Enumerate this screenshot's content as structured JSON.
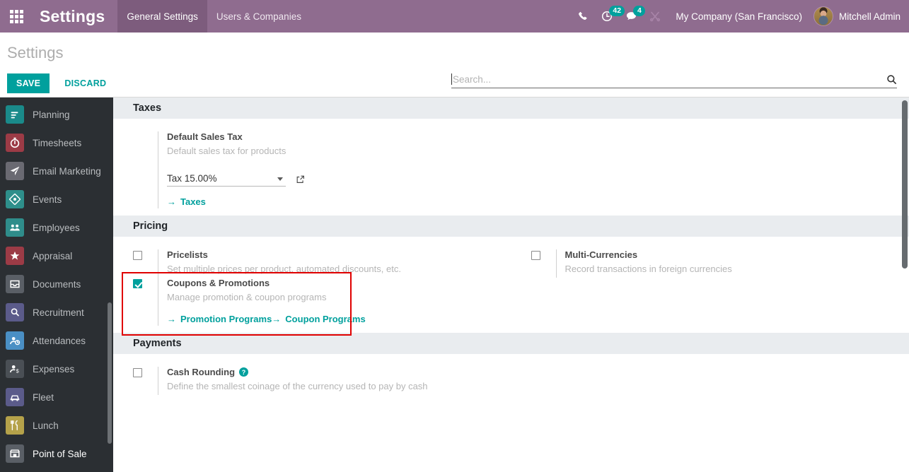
{
  "navbar": {
    "apps_icon": "grid-apps-icon",
    "brand": "Settings",
    "menus": [
      {
        "label": "General Settings",
        "active": true
      },
      {
        "label": "Users & Companies",
        "active": false
      }
    ],
    "icons": [
      {
        "name": "phone-icon",
        "badge": null
      },
      {
        "name": "activity-clock-icon",
        "badge": "42"
      },
      {
        "name": "messages-chat-icon",
        "badge": "4"
      },
      {
        "name": "tools-wrench-icon",
        "badge": null
      }
    ],
    "company": "My Company (San Francisco)",
    "user": "Mitchell Admin",
    "accent_badge_color": "#00A09D",
    "bar_color": "#8f6c8f"
  },
  "control_panel": {
    "title": "Settings",
    "save_label": "SAVE",
    "discard_label": "DISCARD",
    "save_color": "#00A09D"
  },
  "search": {
    "placeholder": "Search...",
    "value": "",
    "icon": "search-icon"
  },
  "sidebar": {
    "items": [
      {
        "label": "Planning",
        "icon_color": "#1a8a8a",
        "glyph": "planning",
        "hover": false
      },
      {
        "label": "Timesheets",
        "icon_color": "#9c3b46",
        "glyph": "timer",
        "hover": false
      },
      {
        "label": "Email Marketing",
        "icon_color": "#6a6a72",
        "glyph": "paperplane",
        "hover": false
      },
      {
        "label": "Events",
        "icon_color": "#2e8f8b",
        "glyph": "ticket",
        "hover": false
      },
      {
        "label": "Employees",
        "icon_color": "#2f8d8b",
        "glyph": "people",
        "hover": false
      },
      {
        "label": "Appraisal",
        "icon_color": "#9c3b46",
        "glyph": "star",
        "hover": false
      },
      {
        "label": "Documents",
        "icon_color": "#5a5f66",
        "glyph": "inbox",
        "hover": false
      },
      {
        "label": "Recruitment",
        "icon_color": "#5b5b8a",
        "glyph": "magnifier",
        "hover": false
      },
      {
        "label": "Attendances",
        "icon_color": "#4a8fc4",
        "glyph": "personclock",
        "hover": false
      },
      {
        "label": "Expenses",
        "icon_color": "#4a4f55",
        "glyph": "persondollar",
        "hover": false
      },
      {
        "label": "Fleet",
        "icon_color": "#5b5b8a",
        "glyph": "car",
        "hover": false
      },
      {
        "label": "Lunch",
        "icon_color": "#b5a24a",
        "glyph": "cutlery",
        "hover": false
      },
      {
        "label": "Point of Sale",
        "icon_color": "#5a5f66",
        "glyph": "shop",
        "hover": true
      }
    ]
  },
  "settings": {
    "sections": [
      {
        "title": "Taxes",
        "blocks": [
          {
            "kind": "select",
            "title": "Default Sales Tax",
            "desc": "Default sales tax for products",
            "select_value": "Tax 15.00%",
            "select_options": [
              "Tax 15.00%"
            ],
            "external_link_icon": "open-external-icon",
            "links": [
              {
                "label": "Taxes"
              }
            ],
            "highlighted": false
          }
        ]
      },
      {
        "title": "Pricing",
        "blocks": [
          {
            "kind": "checkbox",
            "checked": false,
            "title": "Pricelists",
            "desc": "Set multiple prices per product, automated discounts, etc.",
            "links": [],
            "highlighted": false
          },
          {
            "kind": "checkbox",
            "checked": false,
            "title": "Multi-Currencies",
            "desc": "Record transactions in foreign currencies",
            "links": [],
            "highlighted": false
          },
          {
            "kind": "checkbox",
            "checked": true,
            "title": "Coupons & Promotions",
            "desc": "Manage promotion & coupon programs",
            "links": [
              {
                "label": "Promotion Programs"
              },
              {
                "label": "Coupon Programs"
              }
            ],
            "highlighted": true,
            "highlight_color": "#e00000"
          }
        ]
      },
      {
        "title": "Payments",
        "blocks": [
          {
            "kind": "checkbox",
            "checked": false,
            "title": "Cash Rounding",
            "help_icon": "help-question-icon",
            "desc": "Define the smallest coinage of the currency used to pay by cash",
            "links": [],
            "highlighted": false
          }
        ]
      }
    ]
  }
}
